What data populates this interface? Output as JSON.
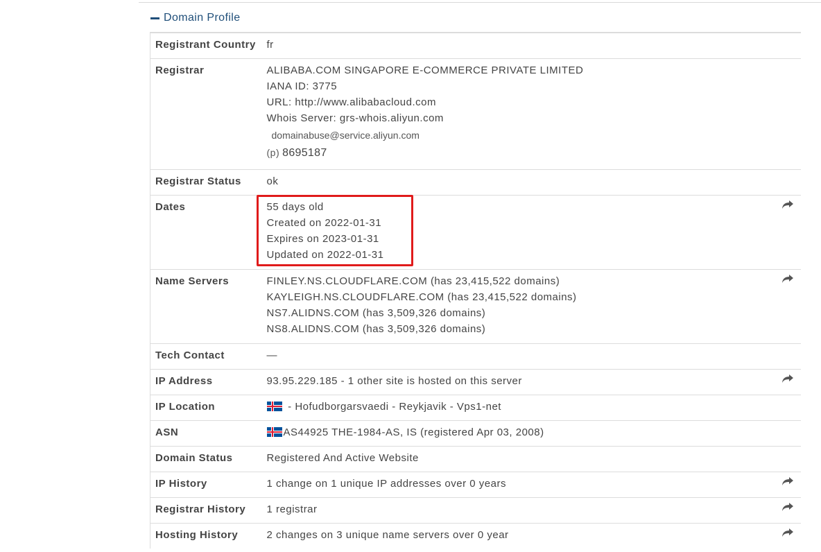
{
  "section": {
    "title": "Domain Profile"
  },
  "rows": {
    "registrant_country": {
      "label": "Registrant Country",
      "value": "fr"
    },
    "registrar": {
      "label": "Registrar",
      "name": "ALIBABA.COM SINGAPORE E-COMMERCE PRIVATE LIMITED",
      "iana": "IANA ID: 3775",
      "url": "URL: http://www.alibabacloud.com",
      "whois": "Whois Server: grs-whois.aliyun.com",
      "email": "domainabuse@service.aliyun.com",
      "phone_prefix": "(p)",
      "phone": "8695187"
    },
    "registrar_status": {
      "label": "Registrar Status",
      "value": "ok"
    },
    "dates": {
      "label": "Dates",
      "age": "55 days old",
      "created": "Created on 2022-01-31",
      "expires": "Expires on 2023-01-31",
      "updated": "Updated on 2022-01-31"
    },
    "name_servers": {
      "label": "Name Servers",
      "items": [
        "FINLEY.NS.CLOUDFLARE.COM (has 23,415,522 domains)",
        "KAYLEIGH.NS.CLOUDFLARE.COM (has 23,415,522 domains)",
        "NS7.ALIDNS.COM (has 3,509,326 domains)",
        "NS8.ALIDNS.COM (has 3,509,326 domains)"
      ]
    },
    "tech_contact": {
      "label": "Tech Contact",
      "value": "—"
    },
    "ip_address": {
      "label": "IP Address",
      "value": "93.95.229.185 - 1 other site is hosted on this server"
    },
    "ip_location": {
      "label": "IP Location",
      "value": " - Hofudborgarsvaedi - Reykjavik - Vps1-net"
    },
    "asn": {
      "label": "ASN",
      "value": "AS44925 THE-1984-AS, IS (registered Apr 03, 2008)"
    },
    "domain_status": {
      "label": "Domain Status",
      "value": "Registered And Active Website"
    },
    "ip_history": {
      "label": "IP History",
      "value": "1 change on 1 unique IP addresses over 0 years"
    },
    "registrar_history": {
      "label": "Registrar History",
      "value": "1 registrar"
    },
    "hosting_history": {
      "label": "Hosting History",
      "value": "2 changes on 3 unique name servers over 0 year"
    }
  },
  "icons": {
    "share": "share-arrow-icon",
    "flag": "iceland-flag-icon",
    "collapse": "minus-icon"
  },
  "colors": {
    "header": "#1f4e79",
    "highlight": "#e01b1b",
    "border": "#dcdcdc"
  }
}
